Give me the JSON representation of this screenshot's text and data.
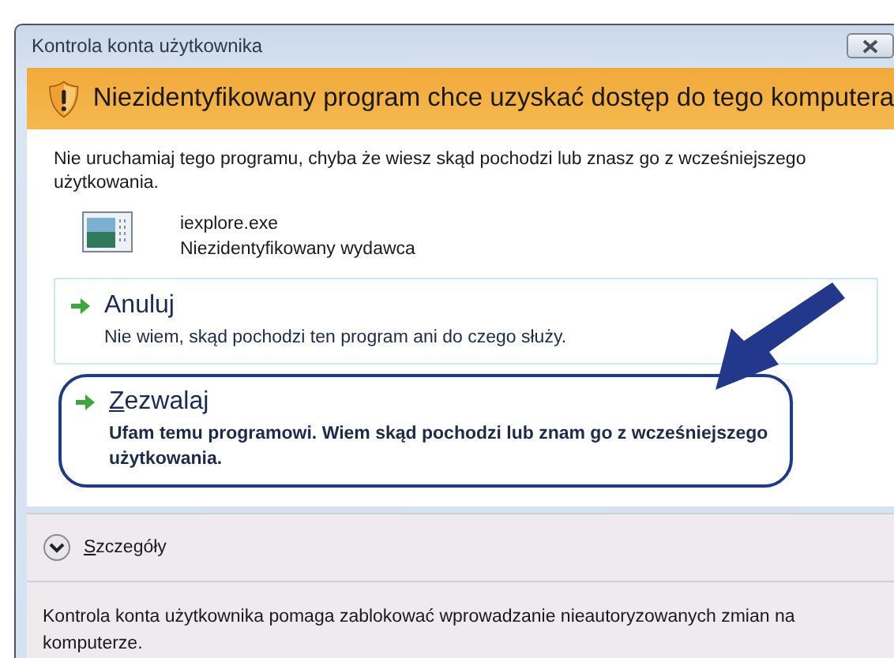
{
  "window": {
    "title": "Kontrola konta użytkownika"
  },
  "banner": {
    "text": "Niezidentyfikowany program chce uzyskać dostęp do tego komputera"
  },
  "warning": "Nie uruchamiaj tego programu, chyba że wiesz skąd pochodzi lub znasz go z wcześniejszego użytkowania.",
  "program": {
    "name": "iexplore.exe",
    "publisher": "Niezidentyfikowany wydawca"
  },
  "options": [
    {
      "title": "Anuluj",
      "description": "Nie wiem, skąd pochodzi ten program ani do czego służy.",
      "highlighted": false,
      "mnemonic": false
    },
    {
      "title": "Zezwalaj",
      "description": "Ufam temu programowi. Wiem skąd pochodzi lub znam go z wcześniejszego użytkowania.",
      "highlighted": true,
      "mnemonic": true
    }
  ],
  "details": {
    "label": "Szczegóły",
    "expanded": false,
    "mnemonic": true
  },
  "footer": "Kontrola konta użytkownika pomaga zablokować wprowadzanie nieautoryzowanych zmian na komputerze."
}
